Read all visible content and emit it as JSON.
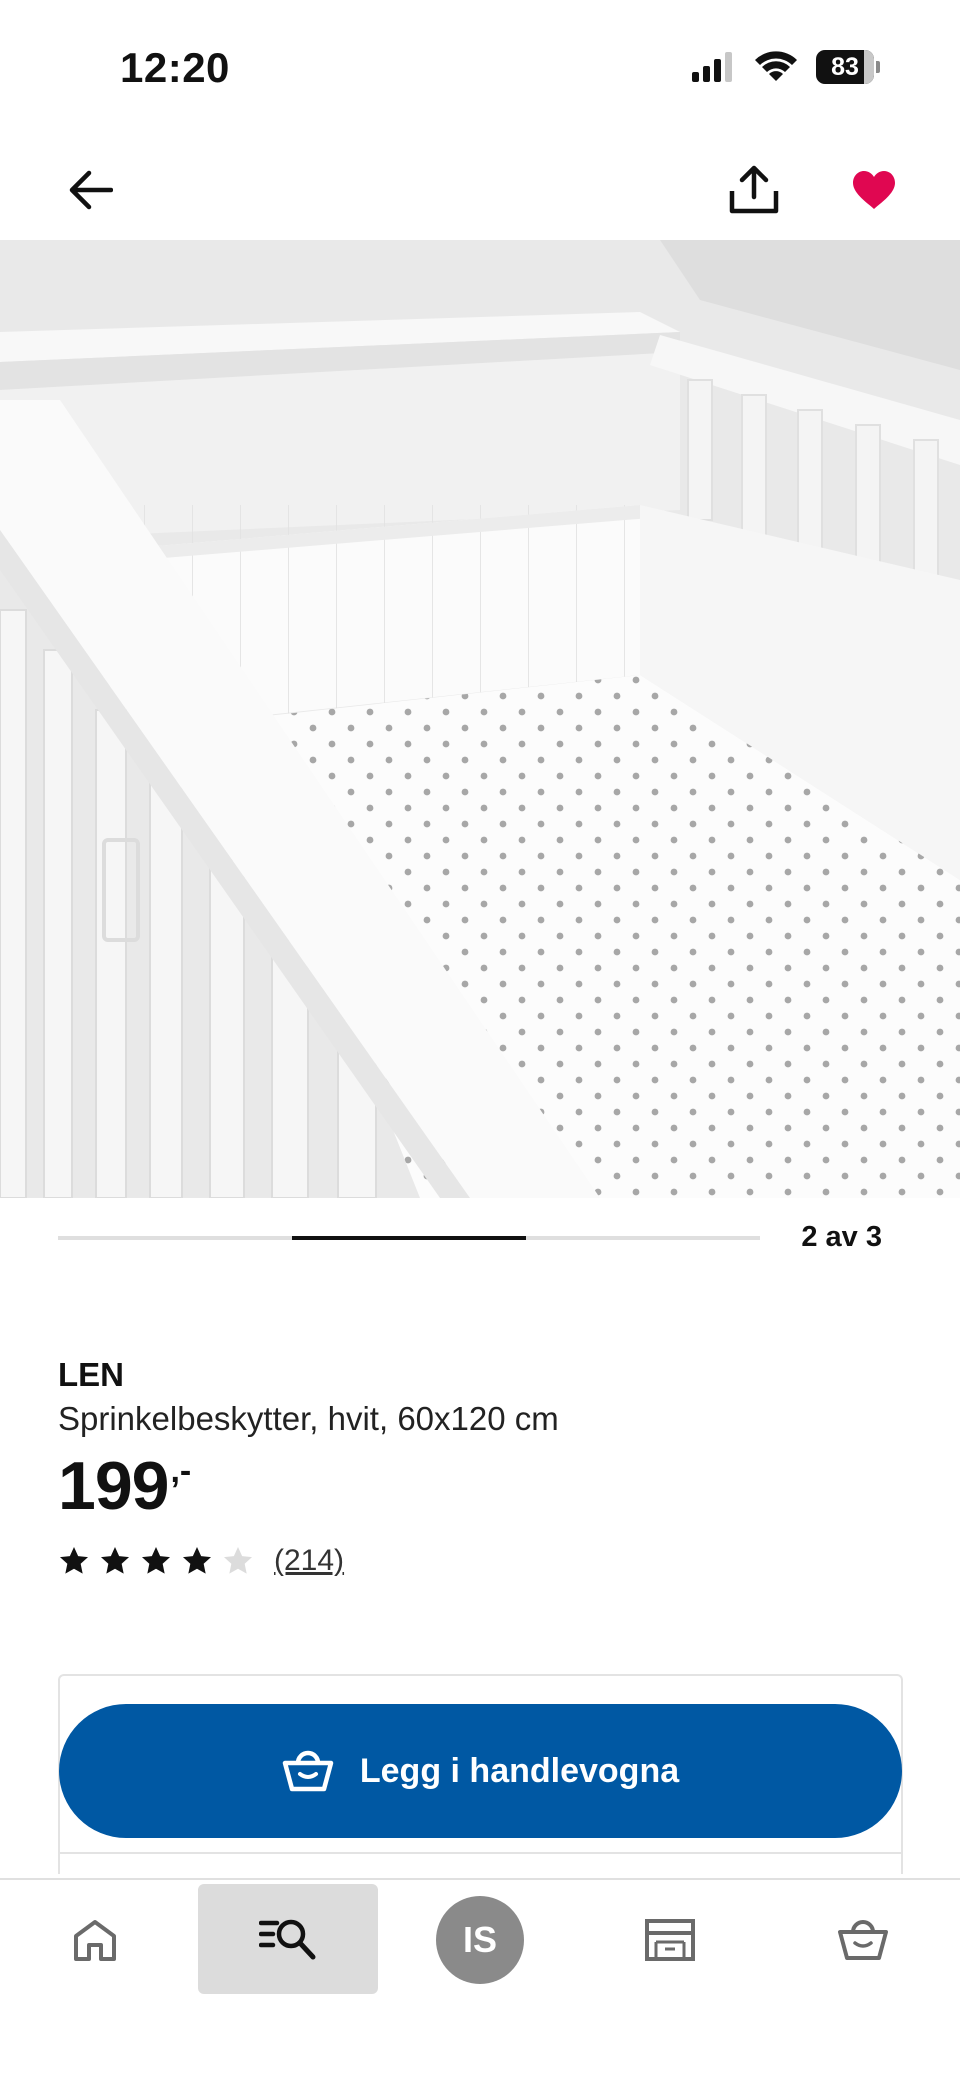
{
  "status_bar": {
    "time": "12:20",
    "battery": "83",
    "icons": [
      "cellular-signal-icon",
      "wifi-icon",
      "battery-icon"
    ]
  },
  "top_nav": {
    "icons": [
      "arrow-left-icon",
      "share-icon",
      "heart-icon"
    ],
    "favorite_color": "#e00751"
  },
  "image_carousel": {
    "counter": "2 av 3",
    "current": 2,
    "total": 3
  },
  "product": {
    "name": "LEN",
    "description": "Sprinkelbeskytter, hvit, 60x120 cm",
    "price": {
      "integer": "199",
      "decimal": ",-"
    },
    "rating": {
      "stars": 4,
      "max": 5,
      "reviews": "(214)"
    }
  },
  "purchase": {
    "add_to_cart_label": "Legg i handlevogna",
    "button_color": "#0058a3"
  },
  "bottom_nav": {
    "profile_initials": "IS",
    "active": "search",
    "icons": [
      "home-icon",
      "search-list-icon",
      "avatar",
      "store-icon",
      "cart-icon"
    ]
  }
}
